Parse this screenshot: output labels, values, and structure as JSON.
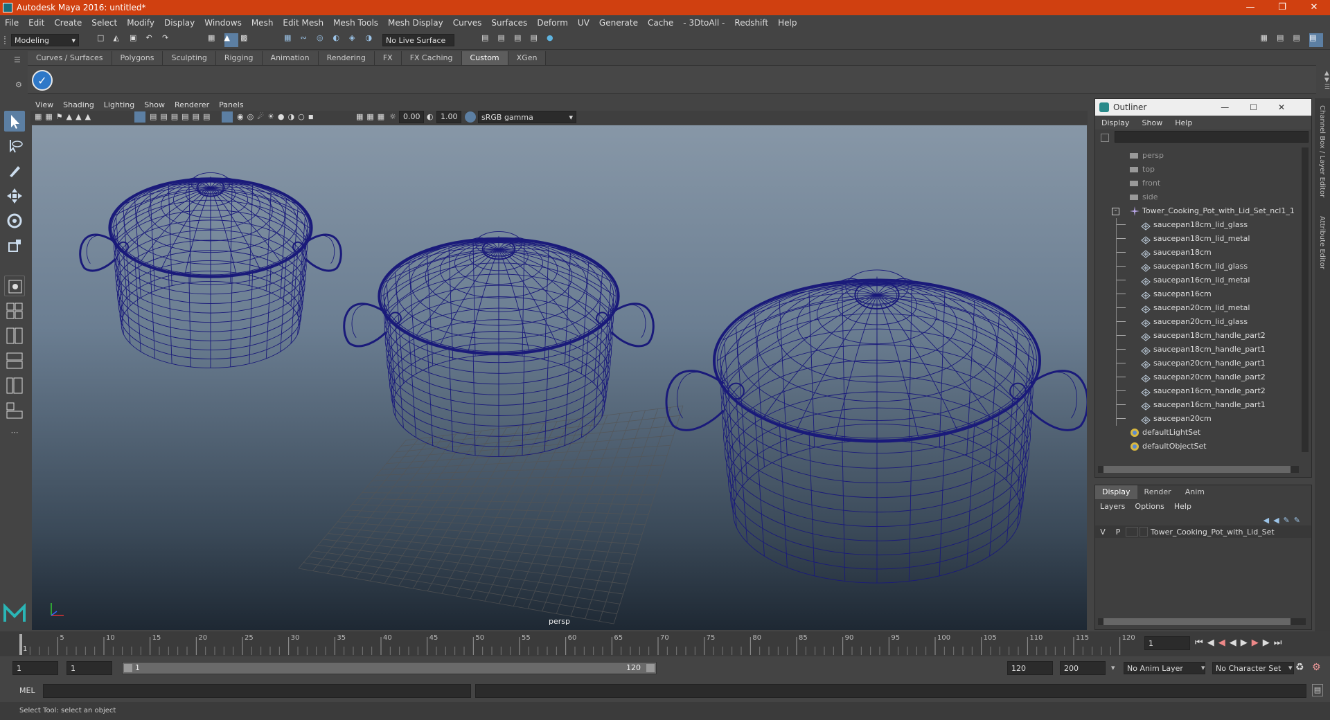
{
  "app": {
    "title": "Autodesk Maya 2016: untitled*"
  },
  "menubar": [
    "File",
    "Edit",
    "Create",
    "Select",
    "Modify",
    "Display",
    "Windows",
    "Mesh",
    "Edit Mesh",
    "Mesh Tools",
    "Mesh Display",
    "Curves",
    "Surfaces",
    "Deform",
    "UV",
    "Generate",
    "Cache",
    "- 3DtoAll -",
    "Redshift",
    "Help"
  ],
  "status": {
    "mode": "Modeling",
    "live_surface": "No Live Surface"
  },
  "shelf_tabs": [
    {
      "label": "Curves / Surfaces",
      "active": false
    },
    {
      "label": "Polygons",
      "active": false
    },
    {
      "label": "Sculpting",
      "active": false
    },
    {
      "label": "Rigging",
      "active": false
    },
    {
      "label": "Animation",
      "active": false
    },
    {
      "label": "Rendering",
      "active": false
    },
    {
      "label": "FX",
      "active": false
    },
    {
      "label": "FX Caching",
      "active": false
    },
    {
      "label": "Custom",
      "active": true
    },
    {
      "label": "XGen",
      "active": false
    }
  ],
  "viewport": {
    "menu": [
      "View",
      "Shading",
      "Lighting",
      "Show",
      "Renderer",
      "Panels"
    ],
    "exposure": "0.00",
    "gamma": "1.00",
    "color_space": "sRGB gamma",
    "camera": "persp",
    "wire_color": "#1a1a7a"
  },
  "outliner": {
    "title": "Outliner",
    "menu": [
      "Display",
      "Show",
      "Help"
    ],
    "items": [
      {
        "label": "persp",
        "type": "camera",
        "indent": 0,
        "dim": true
      },
      {
        "label": "top",
        "type": "camera",
        "indent": 0,
        "dim": true
      },
      {
        "label": "front",
        "type": "camera",
        "indent": 0,
        "dim": true
      },
      {
        "label": "side",
        "type": "camera",
        "indent": 0,
        "dim": true
      },
      {
        "label": "Tower_Cooking_Pot_with_Lid_Set_ncl1_1",
        "type": "group",
        "indent": 0,
        "dim": false
      },
      {
        "label": "saucepan18cm_lid_glass",
        "type": "mesh",
        "indent": 1,
        "dim": false
      },
      {
        "label": "saucepan18cm_lid_metal",
        "type": "mesh",
        "indent": 1,
        "dim": false
      },
      {
        "label": "saucepan18cm",
        "type": "mesh",
        "indent": 1,
        "dim": false
      },
      {
        "label": "saucepan16cm_lid_glass",
        "type": "mesh",
        "indent": 1,
        "dim": false
      },
      {
        "label": "saucepan16cm_lid_metal",
        "type": "mesh",
        "indent": 1,
        "dim": false
      },
      {
        "label": "saucepan16cm",
        "type": "mesh",
        "indent": 1,
        "dim": false
      },
      {
        "label": "saucepan20cm_lid_metal",
        "type": "mesh",
        "indent": 1,
        "dim": false
      },
      {
        "label": "saucepan20cm_lid_glass",
        "type": "mesh",
        "indent": 1,
        "dim": false
      },
      {
        "label": "saucepan18cm_handle_part2",
        "type": "mesh",
        "indent": 1,
        "dim": false
      },
      {
        "label": "saucepan18cm_handle_part1",
        "type": "mesh",
        "indent": 1,
        "dim": false
      },
      {
        "label": "saucepan20cm_handle_part1",
        "type": "mesh",
        "indent": 1,
        "dim": false
      },
      {
        "label": "saucepan20cm_handle_part2",
        "type": "mesh",
        "indent": 1,
        "dim": false
      },
      {
        "label": "saucepan16cm_handle_part2",
        "type": "mesh",
        "indent": 1,
        "dim": false
      },
      {
        "label": "saucepan16cm_handle_part1",
        "type": "mesh",
        "indent": 1,
        "dim": false
      },
      {
        "label": "saucepan20cm",
        "type": "mesh",
        "indent": 1,
        "dim": false
      },
      {
        "label": "defaultLightSet",
        "type": "set",
        "indent": 0,
        "dim": false
      },
      {
        "label": "defaultObjectSet",
        "type": "set",
        "indent": 0,
        "dim": false
      }
    ]
  },
  "layers": {
    "tabs": [
      {
        "label": "Display",
        "active": true
      },
      {
        "label": "Render",
        "active": false
      },
      {
        "label": "Anim",
        "active": false
      }
    ],
    "menu": [
      "Layers",
      "Options",
      "Help"
    ],
    "row": {
      "v": "V",
      "p": "P",
      "name": "Tower_Cooking_Pot_with_Lid_Set"
    }
  },
  "right_strip": {
    "channel_box": "Channel Box / Layer Editor",
    "attribute_editor": "Attribute Editor"
  },
  "timeline": {
    "ticks": [
      "5",
      "10",
      "15",
      "20",
      "25",
      "30",
      "35",
      "40",
      "45",
      "50",
      "55",
      "60",
      "65",
      "70",
      "75",
      "80",
      "85",
      "90",
      "95",
      "100",
      "105",
      "110",
      "115",
      "120"
    ],
    "start_tick": "1",
    "current_frame": "1"
  },
  "range": {
    "start": "1",
    "inner_start": "1",
    "slider_start": "1",
    "slider_end": "120",
    "end": "120",
    "total_end": "200",
    "anim_layer": "No Anim Layer",
    "character_set": "No Character Set"
  },
  "command": {
    "label": "MEL"
  },
  "help_line": "Select Tool: select an object"
}
